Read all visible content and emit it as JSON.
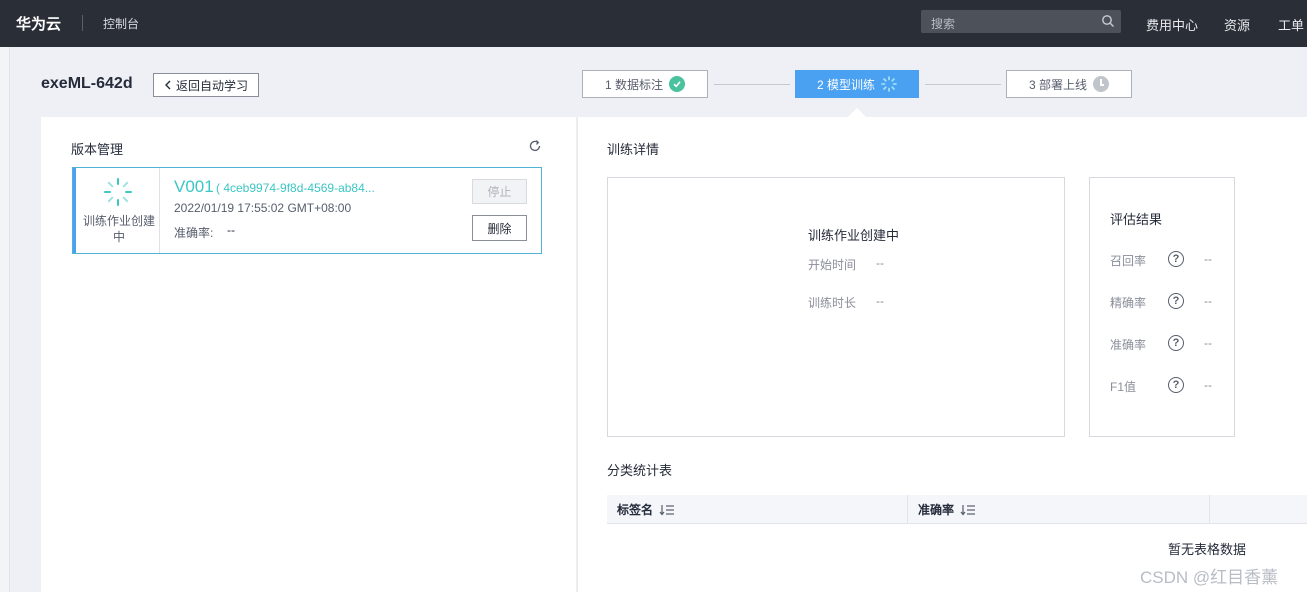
{
  "topbar": {
    "brand": "华为云",
    "console": "控制台",
    "search_placeholder": "搜索",
    "nav": [
      "费用中心",
      "资源",
      "工单"
    ]
  },
  "header": {
    "project_title": "exeML-642d",
    "back_label": "返回自动学习",
    "steps": [
      {
        "label": "1 数据标注",
        "state": "done"
      },
      {
        "label": "2 模型训练",
        "state": "active"
      },
      {
        "label": "3 部署上线",
        "state": "pending"
      }
    ]
  },
  "version_panel": {
    "title": "版本管理",
    "card": {
      "status": "训练作业创建中",
      "name": "V001",
      "id": "( 4ceb9974-9f8d-4569-ab84...",
      "time": "2022/01/19 17:55:02 GMT+08:00",
      "accuracy_label": "准确率:",
      "accuracy_value": "--",
      "stop_label": "停止",
      "delete_label": "删除"
    }
  },
  "details": {
    "title": "训练详情",
    "status": "训练作业创建中",
    "start_label": "开始时间",
    "start_value": "--",
    "duration_label": "训练时长",
    "duration_value": "--"
  },
  "evaluation": {
    "title": "评估结果",
    "metrics": [
      {
        "label": "召回率",
        "value": "--"
      },
      {
        "label": "精确率",
        "value": "--"
      },
      {
        "label": "准确率",
        "value": "--"
      },
      {
        "label": "F1值",
        "value": "--"
      }
    ]
  },
  "classification": {
    "title": "分类统计表",
    "columns": [
      "标签名",
      "准确率"
    ],
    "empty_text": "暂无表格数据"
  },
  "watermark": "CSDN @红目香薰",
  "colors": {
    "topbar": "#2a2e36",
    "accent_blue": "#4aa1f2",
    "teal": "#3cc6c4",
    "success": "#4ac29e"
  }
}
